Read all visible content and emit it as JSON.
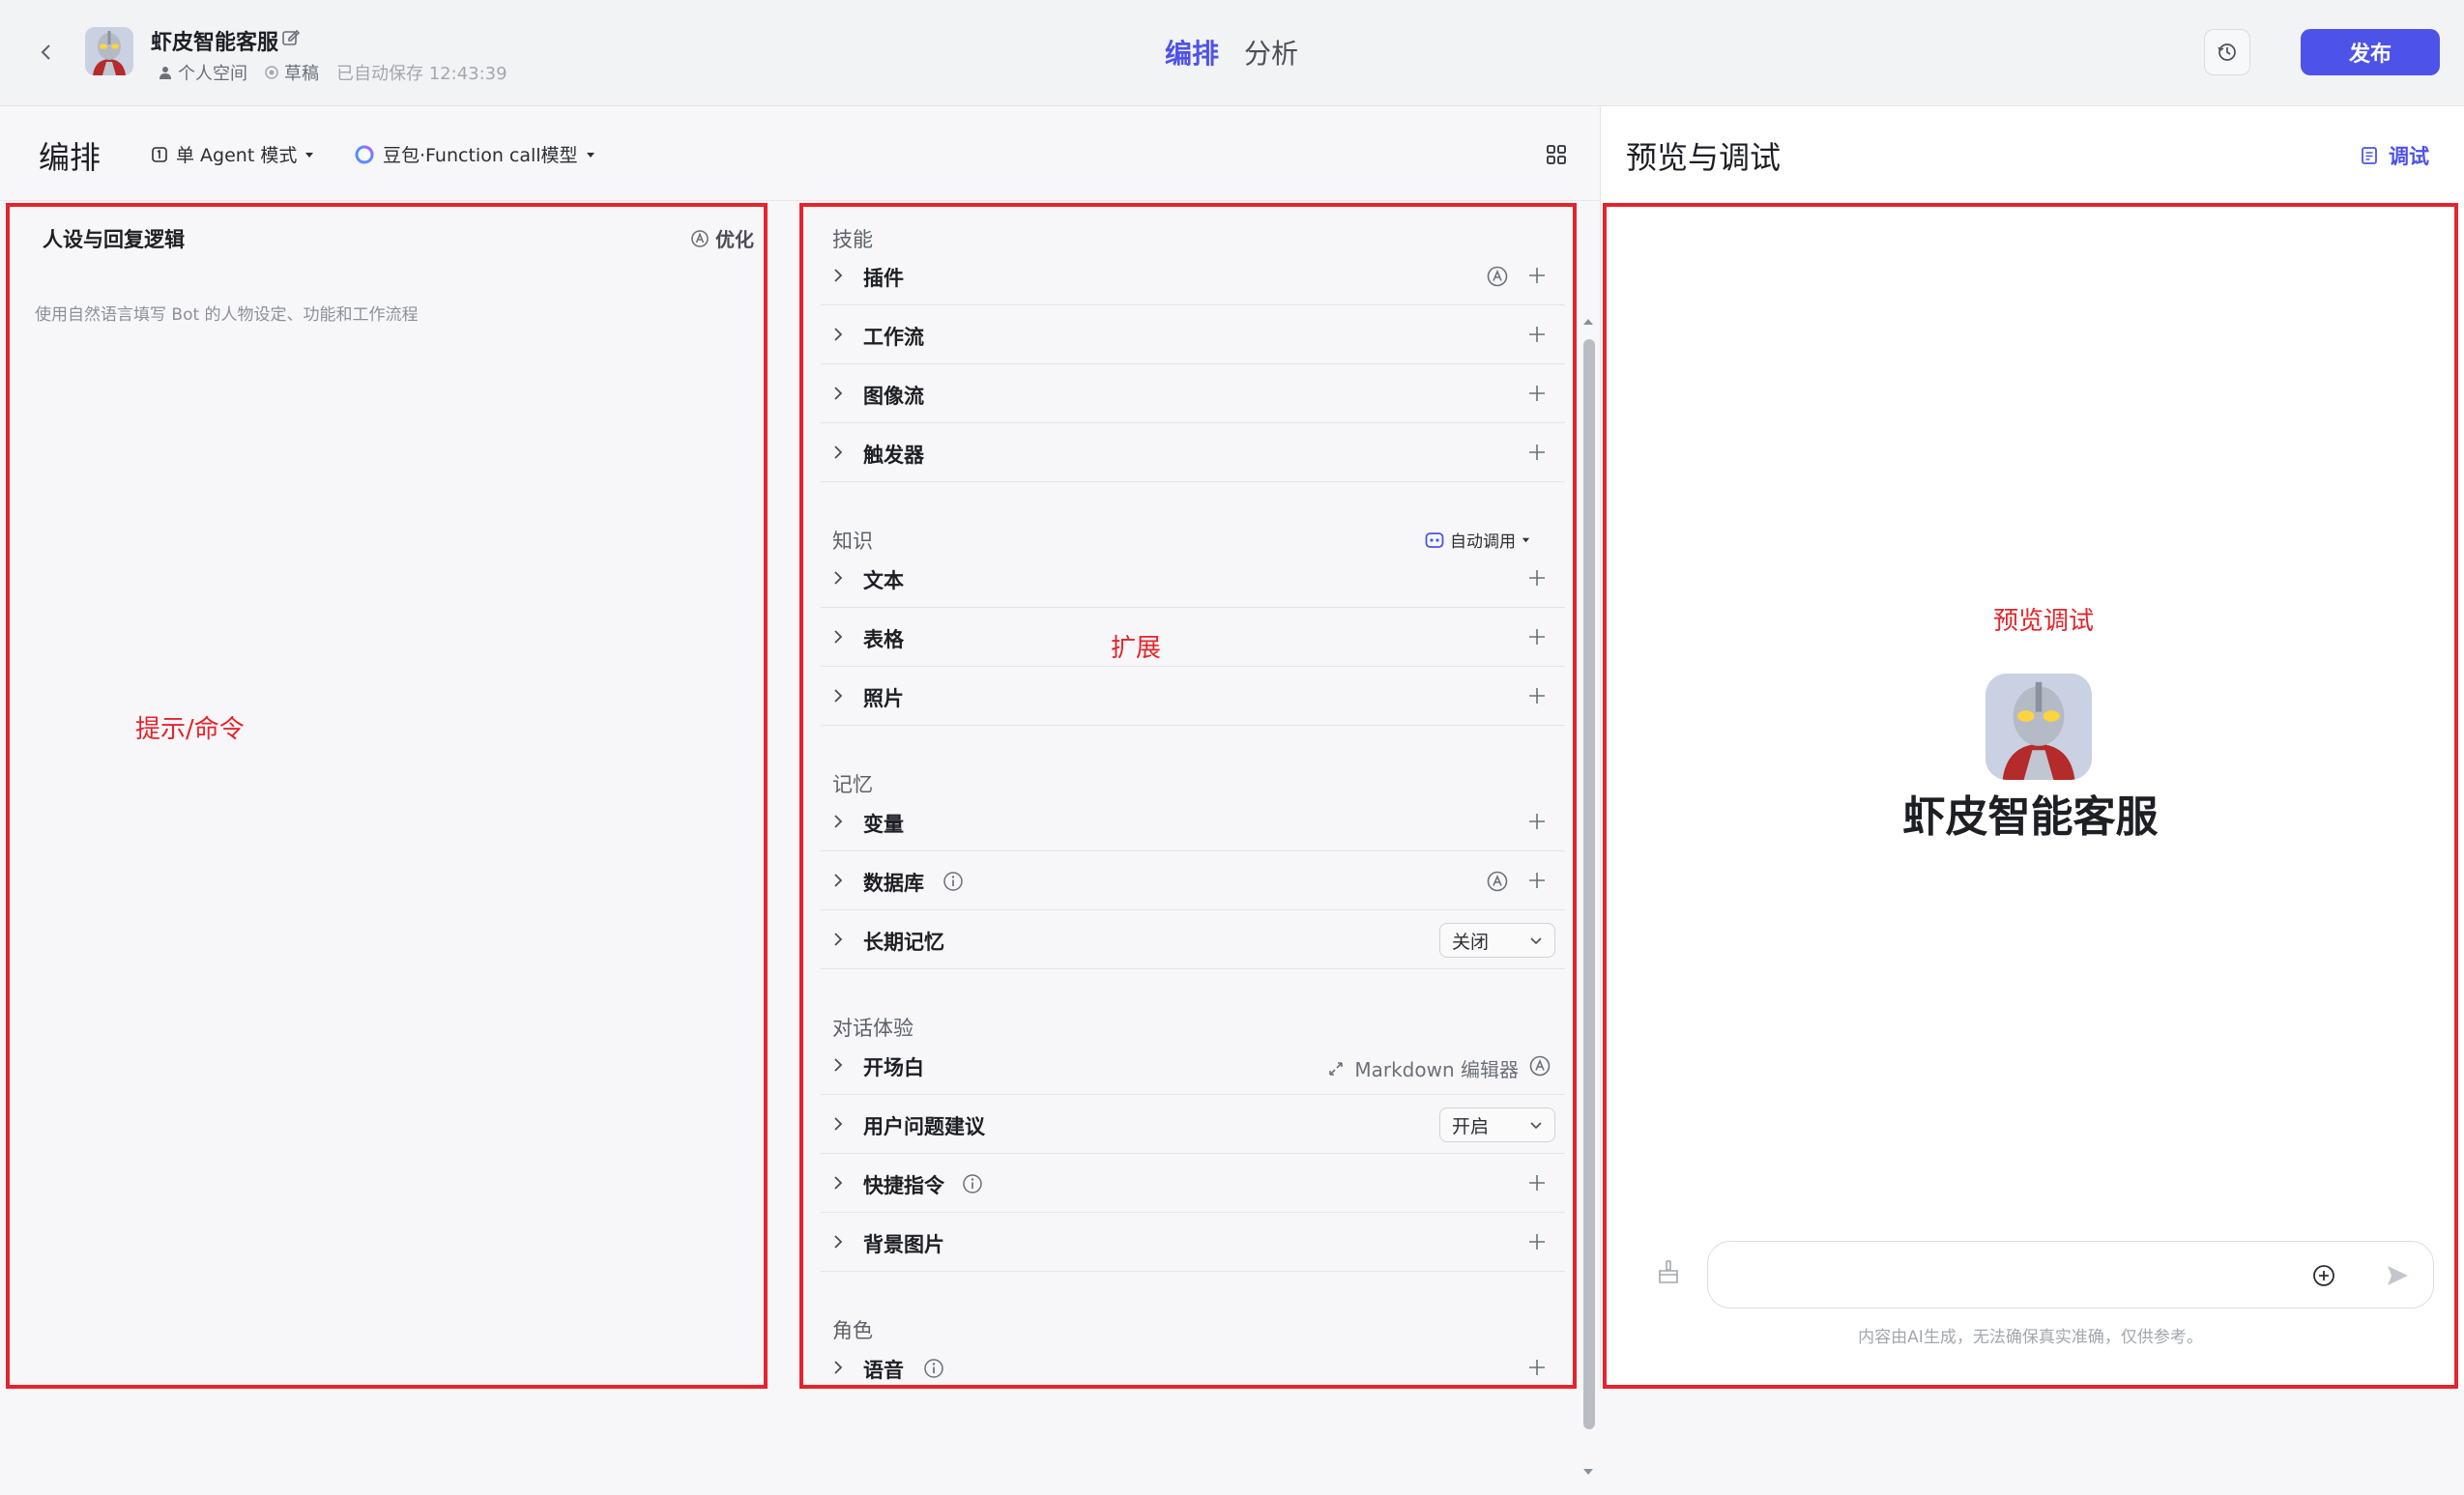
{
  "header": {
    "bot_name": "虾皮智能客服",
    "space": "个人空间",
    "status": "草稿",
    "autosave": "已自动保存 12:43:39",
    "tabs": [
      {
        "label": "编排",
        "active": true
      },
      {
        "label": "分析",
        "active": false
      }
    ],
    "publish_label": "发布"
  },
  "editor": {
    "title": "编排",
    "mode_label": "单 Agent 模式",
    "model_label": "豆包·Function call模型"
  },
  "prompt": {
    "title": "人设与回复逻辑",
    "optimize_label": "优化",
    "placeholder": "使用自然语言填写 Bot 的人物设定、功能和工作流程",
    "annotation": "提示/命令"
  },
  "extensions": {
    "annotation": "扩展",
    "skills": {
      "title": "技能",
      "items": [
        {
          "label": "插件"
        },
        {
          "label": "工作流"
        },
        {
          "label": "图像流"
        },
        {
          "label": "触发器"
        }
      ]
    },
    "knowledge": {
      "title": "知识",
      "auto_call_label": "自动调用",
      "items": [
        {
          "label": "文本"
        },
        {
          "label": "表格"
        },
        {
          "label": "照片"
        }
      ]
    },
    "memory": {
      "title": "记忆",
      "items": [
        {
          "label": "变量"
        },
        {
          "label": "数据库"
        },
        {
          "label": "长期记忆",
          "value": "关闭"
        }
      ]
    },
    "dialog": {
      "title": "对话体验",
      "markdown_label": "Markdown 编辑器",
      "items": [
        {
          "label": "开场白"
        },
        {
          "label": "用户问题建议",
          "value": "开启"
        },
        {
          "label": "快捷指令"
        },
        {
          "label": "背景图片"
        }
      ]
    },
    "role": {
      "title": "角色",
      "items": [
        {
          "label": "语音"
        }
      ]
    }
  },
  "preview": {
    "title": "预览与调试",
    "debug_label": "调试",
    "annotation": "预览调试",
    "bot_name": "虾皮智能客服",
    "chat_placeholder": "",
    "disclaimer": "内容由AI生成，无法确保真实准确，仅供参考。"
  },
  "colors": {
    "accent": "#4d53e8",
    "annotation_red": "#e5242b"
  }
}
